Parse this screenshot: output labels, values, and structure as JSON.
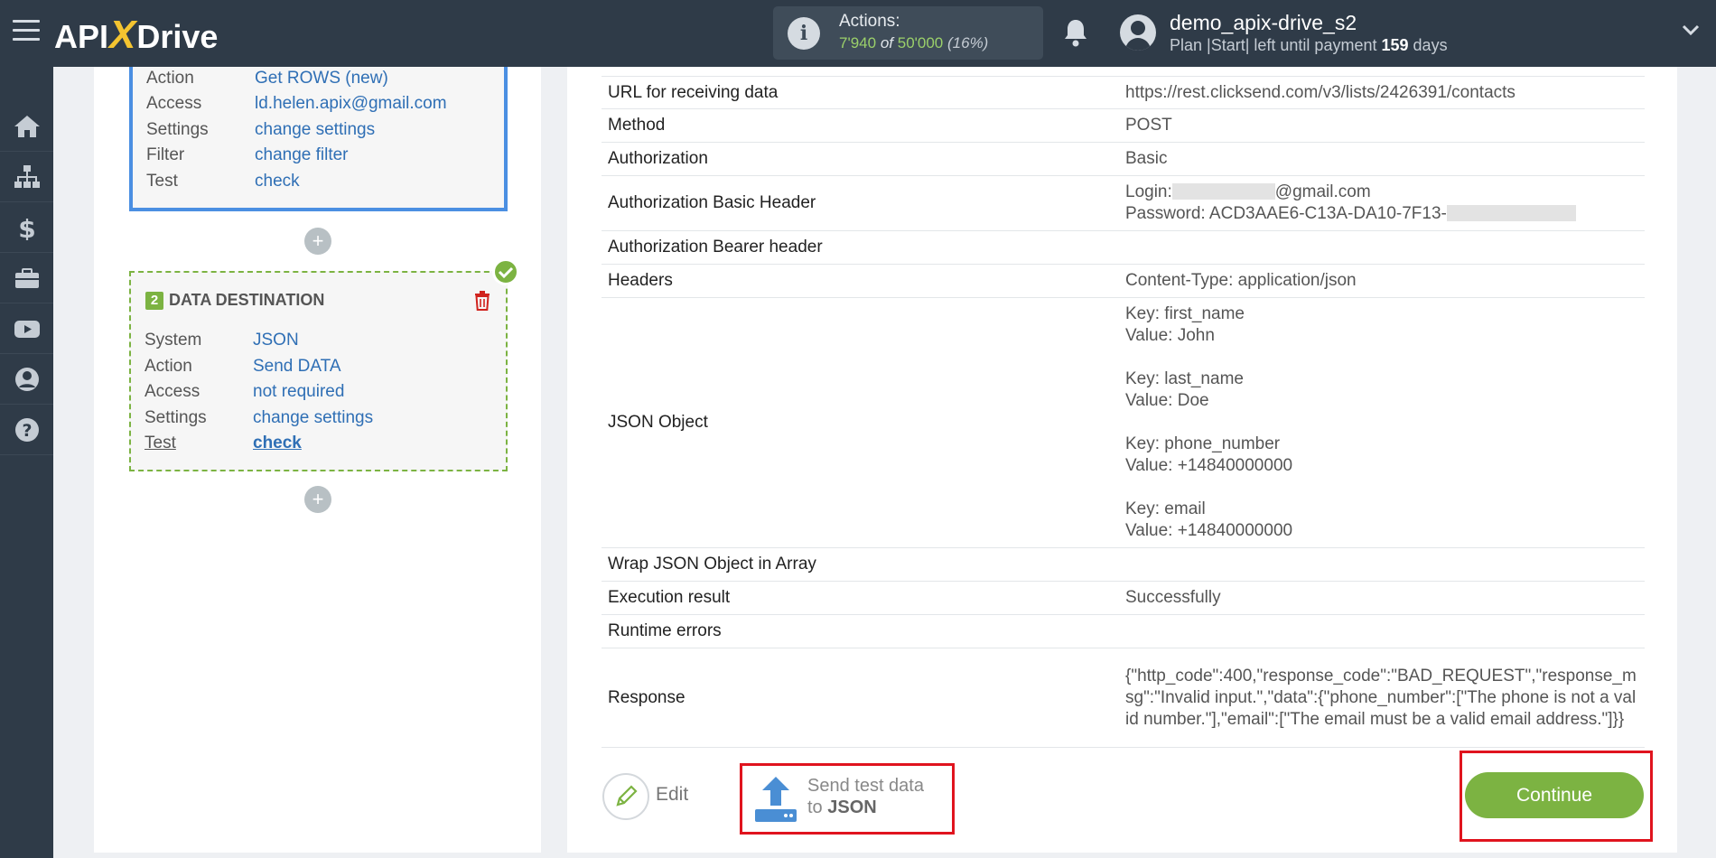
{
  "header": {
    "logo": {
      "left": "API",
      "x": "X",
      "right": "Drive"
    },
    "actions": {
      "label": "Actions:",
      "used": "7'940",
      "of": "of",
      "total": "50'000",
      "percent": "(16%)"
    },
    "user": {
      "name": "demo_apix-drive_s2",
      "plan_text": "Plan |Start| left until payment",
      "days": "159",
      "days_suffix": "days"
    }
  },
  "sidebar": {
    "items": [
      "home-icon",
      "sitemap-icon",
      "dollar-icon",
      "briefcase-icon",
      "youtube-icon",
      "user-icon",
      "help-icon"
    ]
  },
  "source_card": {
    "rows": [
      {
        "key": "Action",
        "value": "Get ROWS (new)"
      },
      {
        "key": "Access",
        "value": "ld.helen.apix@gmail.com"
      },
      {
        "key": "Settings",
        "value": "change settings"
      },
      {
        "key": "Filter",
        "value": "change filter"
      },
      {
        "key": "Test",
        "value": "check"
      }
    ]
  },
  "destination_card": {
    "number": "2",
    "title": "DATA DESTINATION",
    "rows": [
      {
        "key": "System",
        "value": "JSON"
      },
      {
        "key": "Action",
        "value": "Send DATA"
      },
      {
        "key": "Access",
        "value": "not required"
      },
      {
        "key": "Settings",
        "value": "change settings"
      },
      {
        "key": "Test",
        "value": "check"
      }
    ]
  },
  "details": {
    "url_label": "URL for receiving data",
    "url_value": "https://rest.clicksend.com/v3/lists/2426391/contacts",
    "method_label": "Method",
    "method_value": "POST",
    "auth_label": "Authorization",
    "auth_value": "Basic",
    "basic_header_label": "Authorization Basic Header",
    "login_prefix": "Login:",
    "login_suffix": "@gmail.com",
    "password_prefix": "Password: ACD3AAE6-C13A-DA10-7F13-",
    "bearer_label": "Authorization Bearer header",
    "headers_label": "Headers",
    "headers_value": "Content-Type: application/json",
    "json_label": "JSON Object",
    "json_pairs": [
      {
        "key": "Key: first_name",
        "value": "Value: John"
      },
      {
        "key": "Key: last_name",
        "value": "Value: Doe"
      },
      {
        "key": "Key: phone_number",
        "value": "Value: +14840000000"
      },
      {
        "key": "Key: email",
        "value": "Value: +14840000000"
      }
    ],
    "wrap_label": "Wrap JSON Object in Array",
    "exec_label": "Execution result",
    "exec_value": "Successfully",
    "runtime_label": "Runtime errors",
    "response_label": "Response",
    "response_value": "{\"http_code\":400,\"response_code\":\"BAD_REQUEST\",\"response_msg\":\"Invalid input.\",\"data\":{\"phone_number\":[\"The phone is not a valid number.\"],\"email\":[\"The email must be a valid email address.\"]}}"
  },
  "footer": {
    "edit_label": "Edit",
    "send_line1": "Send test data",
    "send_line2_prefix": "to",
    "send_line2_bold": "JSON",
    "continue_label": "Continue"
  },
  "colors": {
    "accent_green": "#7cb342",
    "link_blue": "#2f6fb5",
    "highlight_red": "#e0141e",
    "dark_bar": "#2f3b48"
  }
}
